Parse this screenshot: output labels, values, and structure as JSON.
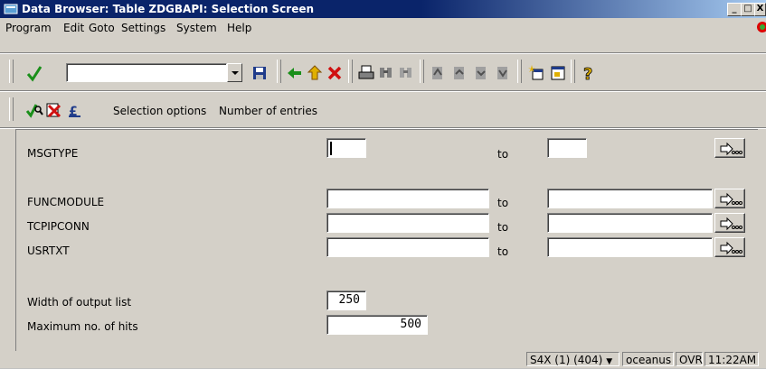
{
  "window": {
    "title": "Data Browser: Table ZDGBAPI: Selection Screen"
  },
  "window_buttons": {
    "minimize": "_",
    "maximize": "□",
    "close": "X"
  },
  "menu": {
    "items": [
      "Program",
      "Edit",
      "Goto",
      "Settings",
      "System",
      "Help"
    ]
  },
  "toolbar": {
    "command_field": {
      "value": ""
    }
  },
  "app_toolbar": {
    "selection_options": "Selection options",
    "number_of_entries": "Number of entries"
  },
  "form": {
    "to_label": "to",
    "fields": [
      {
        "label": "MSGTYPE",
        "from": "",
        "to": ""
      },
      {
        "label": "FUNCMODULE",
        "from": "",
        "to": ""
      },
      {
        "label": "TCPIPCONN",
        "from": "",
        "to": ""
      },
      {
        "label": "USRTXT",
        "from": "",
        "to": ""
      }
    ],
    "width_label": "Width of output list",
    "width_value": "250",
    "maxhits_label": "Maximum no. of hits",
    "maxhits_value": "500"
  },
  "status": {
    "system": "S4X (1) (404)",
    "user": "oceanus",
    "mode": "OVR",
    "time": "11:22AM"
  },
  "icons": {
    "title": "sap-window-icon",
    "enter": "check-icon",
    "save": "save-icon",
    "back": "back-icon",
    "exit": "exit-icon",
    "cancel": "cancel-icon",
    "print": "print-icon",
    "find": "find-icon",
    "find_next": "find-next-icon",
    "first_page": "first-page-icon",
    "prev_page": "prev-page-icon",
    "next_page": "next-page-icon",
    "last_page": "last-page-icon",
    "new_session": "new-session-icon",
    "shortcut": "shortcut-icon",
    "help": "help-icon",
    "execute": "execute-icon",
    "delete_selection": "delete-selection-icon",
    "get_variant": "get-variant-icon",
    "multiple_selection": "multiple-selection-icon"
  }
}
